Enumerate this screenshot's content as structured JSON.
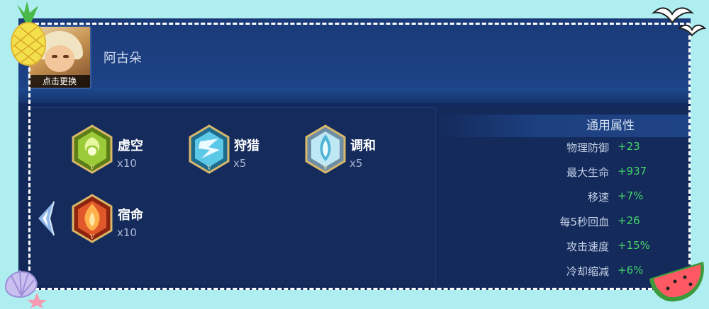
{
  "hero": {
    "name": "阿古朵",
    "avatar_caption": "点击更换"
  },
  "runes": [
    {
      "name": "虚空",
      "count": "x10",
      "icon": "void-rune-icon",
      "color": "#9ccb3a"
    },
    {
      "name": "狩猎",
      "count": "x5",
      "icon": "hunt-rune-icon",
      "color": "#5cc8e8"
    },
    {
      "name": "调和",
      "count": "x5",
      "icon": "harmony-rune-icon",
      "color": "#bfe8f5"
    },
    {
      "name": "宿命",
      "count": "x10",
      "icon": "fate-rune-icon",
      "color": "#e0572a"
    }
  ],
  "attributes": {
    "title": "通用属性",
    "rows": [
      {
        "label": "物理防御",
        "value": "+23"
      },
      {
        "label": "最大生命",
        "value": "+937"
      },
      {
        "label": "移速",
        "value": "+7%"
      },
      {
        "label": "每5秒回血",
        "value": "+26"
      },
      {
        "label": "攻击速度",
        "value": "+15%"
      },
      {
        "label": "冷却缩减",
        "value": "+6%"
      }
    ]
  },
  "colors": {
    "value_green": "#44d36a",
    "panel_bg": "#132a5e",
    "page_bg": "#aeeef0"
  }
}
